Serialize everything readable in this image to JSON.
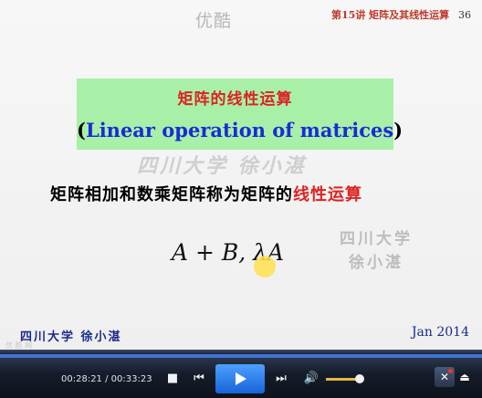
{
  "watermark_top": "优酷",
  "header": {
    "lecture": "第15讲 矩阵及其线性运算",
    "page": "36"
  },
  "title": {
    "zh": "矩阵的线性运算",
    "open_paren": "(",
    "en": "Linear operation of matrices",
    "close_paren": ")"
  },
  "watermark_mid": "四川大学 徐小湛",
  "definition": {
    "prefix": "矩阵相加和数乘矩阵称为矩阵的",
    "highlight": "线性运算"
  },
  "formula": "A + B,  λA",
  "watermark_right": {
    "line1": "四川大学",
    "line2": "徐小湛"
  },
  "footer": {
    "left": "四川大学   徐小湛",
    "right": "Jan 2014"
  },
  "tiny_watermark": "优 酷 网",
  "player": {
    "time": "00:28:21 / 00:33:23",
    "stop_icon": "stop-icon",
    "prev_icon": "prev-icon",
    "play_icon": "play-icon",
    "next_icon": "next-icon",
    "volume_icon": "volume-icon",
    "tools_icon": "tools-icon",
    "eject_icon": "eject-icon",
    "volume_level": 0.88,
    "progress": 0.849
  }
}
